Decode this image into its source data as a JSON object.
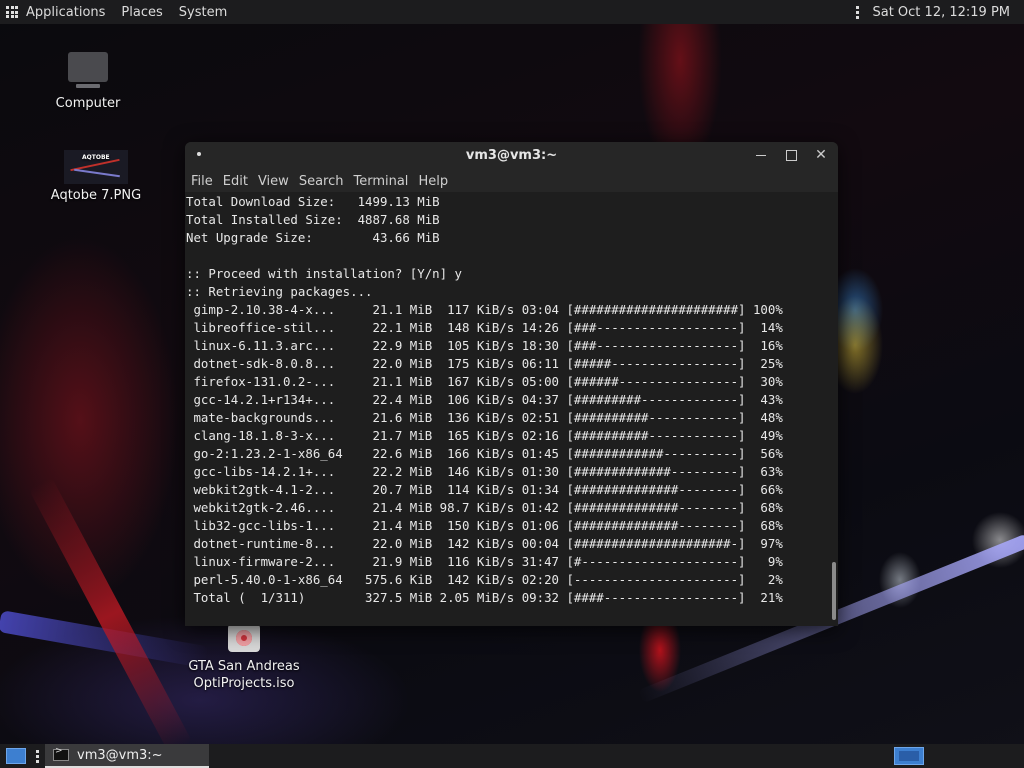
{
  "top_panel": {
    "applications": "Applications",
    "places": "Places",
    "system": "System",
    "clock": "Sat Oct 12, 12:19 PM"
  },
  "desktop": {
    "icons": [
      {
        "label": "Computer",
        "icon": "computer-icon"
      },
      {
        "label": "Aqtobe 7.PNG",
        "icon": "image-file-icon",
        "thumb_text": "AQTOBE"
      },
      {
        "label": "GTA San Andreas OptiProjects.iso",
        "icon": "disc-image-icon"
      }
    ]
  },
  "terminal": {
    "title": "vm3@vm3:~",
    "menu": [
      "File",
      "Edit",
      "View",
      "Search",
      "Terminal",
      "Help"
    ],
    "header_lines": [
      "Total Download Size:   1499.13 MiB",
      "Total Installed Size:  4887.68 MiB",
      "Net Upgrade Size:        43.66 MiB",
      "",
      ":: Proceed with installation? [Y/n] y",
      ":: Retrieving packages..."
    ],
    "packages": [
      {
        "name": "gimp-2.10.38-4-x...",
        "size": "21.1 MiB",
        "speed": "117 KiB/s",
        "eta": "03:04",
        "bar": "[######################]",
        "percent": "100%"
      },
      {
        "name": "libreoffice-stil...",
        "size": "22.1 MiB",
        "speed": "148 KiB/s",
        "eta": "14:26",
        "bar": "[###-------------------]",
        "percent": "14%"
      },
      {
        "name": "linux-6.11.3.arc...",
        "size": "22.9 MiB",
        "speed": "105 KiB/s",
        "eta": "18:30",
        "bar": "[###-------------------]",
        "percent": "16%"
      },
      {
        "name": "dotnet-sdk-8.0.8...",
        "size": "22.0 MiB",
        "speed": "175 KiB/s",
        "eta": "06:11",
        "bar": "[#####-----------------]",
        "percent": "25%"
      },
      {
        "name": "firefox-131.0.2-...",
        "size": "21.1 MiB",
        "speed": "167 KiB/s",
        "eta": "05:00",
        "bar": "[######----------------]",
        "percent": "30%"
      },
      {
        "name": "gcc-14.2.1+r134+...",
        "size": "22.4 MiB",
        "speed": "106 KiB/s",
        "eta": "04:37",
        "bar": "[#########-------------]",
        "percent": "43%"
      },
      {
        "name": "mate-backgrounds...",
        "size": "21.6 MiB",
        "speed": "136 KiB/s",
        "eta": "02:51",
        "bar": "[##########------------]",
        "percent": "48%"
      },
      {
        "name": "clang-18.1.8-3-x...",
        "size": "21.7 MiB",
        "speed": "165 KiB/s",
        "eta": "02:16",
        "bar": "[##########------------]",
        "percent": "49%"
      },
      {
        "name": "go-2:1.23.2-1-x86_64",
        "size": "22.6 MiB",
        "speed": "166 KiB/s",
        "eta": "01:45",
        "bar": "[############----------]",
        "percent": "56%"
      },
      {
        "name": "gcc-libs-14.2.1+...",
        "size": "22.2 MiB",
        "speed": "146 KiB/s",
        "eta": "01:30",
        "bar": "[#############---------]",
        "percent": "63%"
      },
      {
        "name": "webkit2gtk-4.1-2...",
        "size": "20.7 MiB",
        "speed": "114 KiB/s",
        "eta": "01:34",
        "bar": "[##############--------]",
        "percent": "66%"
      },
      {
        "name": "webkit2gtk-2.46....",
        "size": "21.4 MiB",
        "speed": "98.7 KiB/s",
        "eta": "01:42",
        "bar": "[##############--------]",
        "percent": "68%"
      },
      {
        "name": "lib32-gcc-libs-1...",
        "size": "21.4 MiB",
        "speed": "150 KiB/s",
        "eta": "01:06",
        "bar": "[##############--------]",
        "percent": "68%"
      },
      {
        "name": "dotnet-runtime-8...",
        "size": "22.0 MiB",
        "speed": "142 KiB/s",
        "eta": "00:04",
        "bar": "[#####################-]",
        "percent": "97%"
      },
      {
        "name": "linux-firmware-2...",
        "size": "21.9 MiB",
        "speed": "116 KiB/s",
        "eta": "31:47",
        "bar": "[#---------------------]",
        "percent": "9%"
      },
      {
        "name": "perl-5.40.0-1-x86_64",
        "size": "575.6 KiB",
        "speed": "142 KiB/s",
        "eta": "02:20",
        "bar": "[----------------------]",
        "percent": "2%"
      },
      {
        "name": "Total (  1/311)",
        "size": "327.5 MiB",
        "speed": "2.05 MiB/s",
        "eta": "09:32",
        "bar": "[####------------------]",
        "percent": "21%"
      }
    ]
  },
  "taskbar": {
    "task_label": "vm3@vm3:~"
  },
  "colors": {
    "panel_bg": "#1c1c1e",
    "terminal_bg": "#1e1e1e",
    "accent": "#3d7fd0"
  }
}
